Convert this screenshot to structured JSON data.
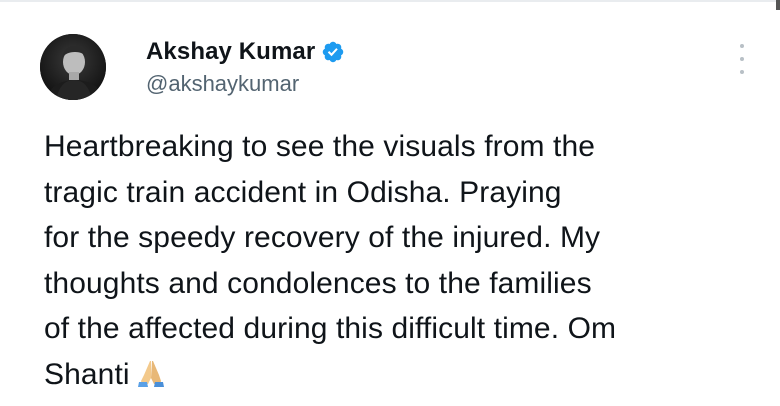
{
  "author": {
    "display_name": "Akshay Kumar",
    "handle": "@akshaykumar",
    "verified": true,
    "avatar_icon": "profile-photo-icon",
    "verified_badge_color": "#1d9bf0"
  },
  "tweet": {
    "lines": [
      "Heartbreaking to see the visuals from the",
      "tragic train accident in Odisha. Praying",
      "for the speedy recovery of the injured. My",
      "thoughts and condolences to the families",
      "of the affected during this difficult time. Om",
      "Shanti"
    ],
    "emoji_icon": "folded-hands-icon"
  },
  "menu": {
    "icon": "more-options-icon"
  },
  "colors": {
    "text": "#0f1419",
    "secondary_text": "#536471",
    "accent": "#1d9bf0"
  }
}
